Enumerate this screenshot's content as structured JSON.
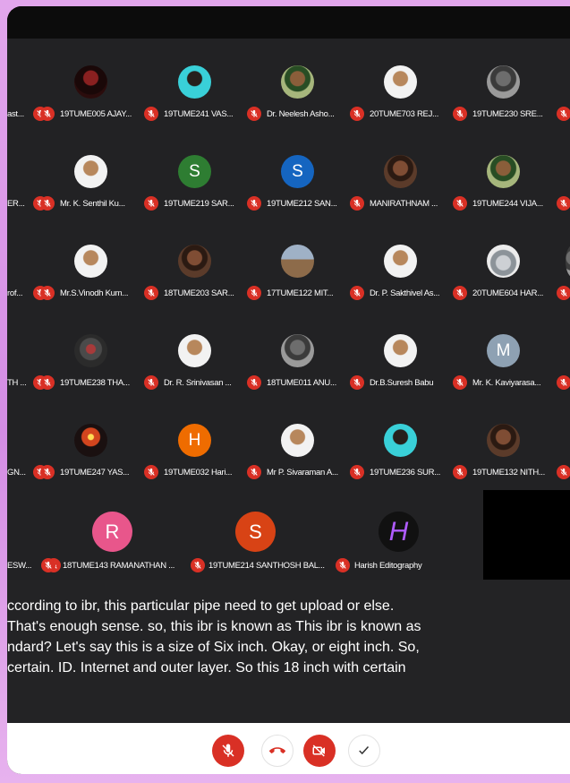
{
  "colors": {
    "muted_mic": "#d93025",
    "grid_bg": "#222224",
    "caption_bg": "#232325"
  },
  "left_edge_names": [
    "ast...",
    "ER...",
    "rof...",
    "TH ...",
    "GN..."
  ],
  "participants": [
    {
      "name": "19TUME005 AJAY...",
      "avatar": "photo",
      "style": "dark"
    },
    {
      "name": "19TUME241 VAS...",
      "avatar": "photo",
      "style": "teal"
    },
    {
      "name": "Dr. Neelesh Asho...",
      "avatar": "photo",
      "style": "green"
    },
    {
      "name": "20TUME703 REJ...",
      "avatar": "photo",
      "style": "beige"
    },
    {
      "name": "19TUME230 SRE...",
      "avatar": "photo",
      "style": "mono"
    },
    {
      "name": "Mr. K. Senthil Ku...",
      "avatar": "photo",
      "style": "beige"
    },
    {
      "name": "19TUME219 SAR...",
      "avatar": "letter",
      "letter": "S",
      "color": "#2e7d32"
    },
    {
      "name": "19TUME212 SAN...",
      "avatar": "letter",
      "letter": "S",
      "color": "#1565c0"
    },
    {
      "name": "MANIRATHNAM ...",
      "avatar": "photo",
      "style": "brown"
    },
    {
      "name": "19TUME244 VIJA...",
      "avatar": "photo",
      "style": "green"
    },
    {
      "name": "Mr.S.Vinodh Kum...",
      "avatar": "photo",
      "style": "beige"
    },
    {
      "name": "18TUME203 SAR...",
      "avatar": "photo",
      "style": "brown"
    },
    {
      "name": "17TUME122 MIT...",
      "avatar": "photo",
      "style": "tower"
    },
    {
      "name": "Dr. P. Sakthivel As...",
      "avatar": "photo",
      "style": "beige"
    },
    {
      "name": "20TUME604 HAR...",
      "avatar": "photo",
      "style": "road"
    },
    {
      "name": "19TUME238 THA...",
      "avatar": "photo",
      "style": "smoke"
    },
    {
      "name": "Dr. R. Srinivasan ...",
      "avatar": "photo",
      "style": "beige"
    },
    {
      "name": "18TUME011 ANU...",
      "avatar": "photo",
      "style": "mono"
    },
    {
      "name": "Dr.B.Suresh Babu",
      "avatar": "photo",
      "style": "beige"
    },
    {
      "name": "Mr. K. Kaviyarasa...",
      "avatar": "letter",
      "letter": "M",
      "color": "#8ea1b3"
    },
    {
      "name": "19TUME247 YAS...",
      "avatar": "photo",
      "style": "orange"
    },
    {
      "name": "19TUME032 Hari...",
      "avatar": "letter",
      "letter": "H",
      "color": "#ef6c00"
    },
    {
      "name": "Mr P. Sivaraman A...",
      "avatar": "photo",
      "style": "beige"
    },
    {
      "name": "19TUME236 SUR...",
      "avatar": "photo",
      "style": "teal"
    },
    {
      "name": "19TUME132 NITH...",
      "avatar": "photo",
      "style": "brown"
    }
  ],
  "bottom_row": {
    "left_edge": "ESW...",
    "tiles": [
      {
        "name": "18TUME143 RAMANATHAN ...",
        "letter": "R",
        "color": "#e8568b"
      },
      {
        "name": "19TUME214 SANTHOSH BAL...",
        "letter": "S",
        "color": "#d84315"
      },
      {
        "name": "Harish Editography",
        "letter": "H",
        "color": "#111111"
      }
    ]
  },
  "captions": [
    "ccording to ibr, this particular pipe need to get upload or else.",
    "That's enough sense. so, this ibr is known as This ibr is known as",
    "ndard? Let's say this is a size of Six inch. Okay, or eight inch. So,",
    "certain. ID. Internet and outer layer. So this 18 inch with certain"
  ],
  "controls": [
    {
      "name": "mic-off-button",
      "icon": "mic-off-icon",
      "style": "red"
    },
    {
      "name": "end-call-button",
      "icon": "phone-hangup-icon",
      "style": "white"
    },
    {
      "name": "camera-off-button",
      "icon": "video-off-icon",
      "style": "red"
    },
    {
      "name": "captions-check-button",
      "icon": "check-icon",
      "style": "white"
    }
  ]
}
